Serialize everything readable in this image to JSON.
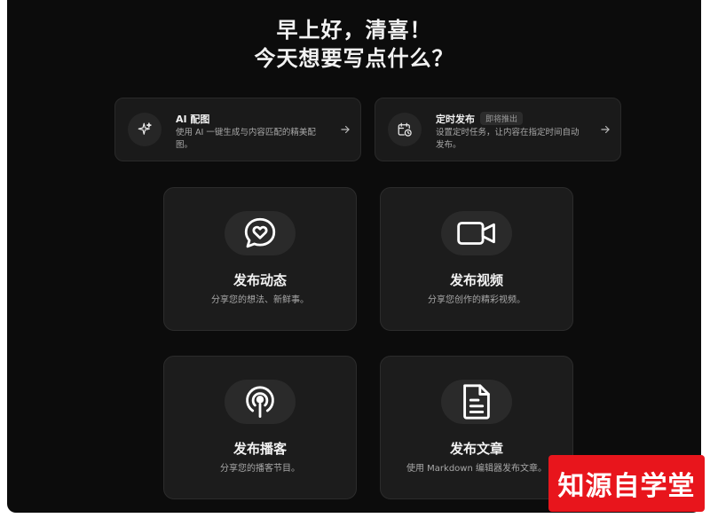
{
  "greeting": {
    "line1": "早上好，清喜！",
    "line2": "今天想要写点什么？"
  },
  "features": [
    {
      "title": "AI 配图",
      "badge": "",
      "description": "使用 AI 一键生成与内容匹配的精美配图。",
      "icon": "sparkle-icon"
    },
    {
      "title": "定时发布",
      "badge": "即将推出",
      "description": "设置定时任务，让内容在指定时间自动发布。",
      "icon": "calendar-clock-icon"
    }
  ],
  "cards": [
    {
      "title": "发布动态",
      "description": "分享您的想法、新鲜事。",
      "icon": "chat-heart-icon"
    },
    {
      "title": "发布视频",
      "description": "分享您创作的精彩视频。",
      "icon": "video-camera-icon"
    },
    {
      "title": "发布播客",
      "description": "分享您的播客节目。",
      "icon": "podcast-icon"
    },
    {
      "title": "发布文章",
      "description": "使用 Markdown 编辑器发布文章。",
      "icon": "document-icon"
    }
  ],
  "watermark": {
    "text": "知源自学堂"
  },
  "colors": {
    "background": "#0c0c0c",
    "card": "#1c1c1c",
    "watermark": "#e8151c"
  }
}
